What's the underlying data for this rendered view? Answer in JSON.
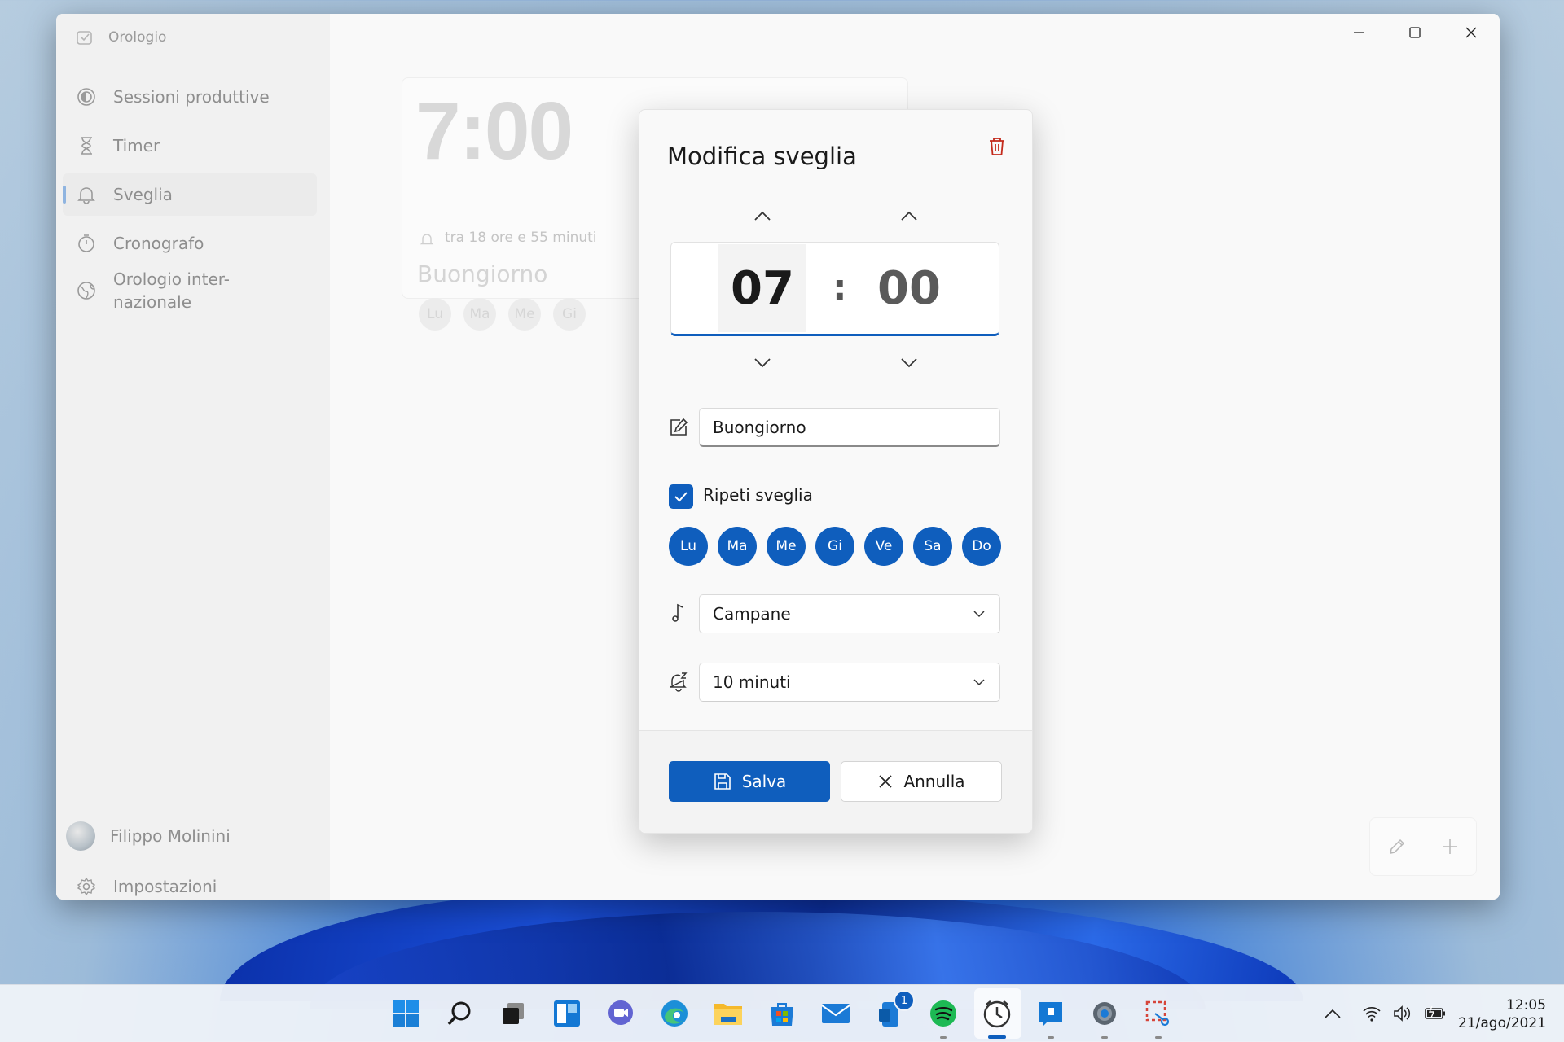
{
  "app": {
    "title": "Orologio"
  },
  "sidebar": {
    "items": [
      {
        "label": "Sessioni produttive"
      },
      {
        "label": "Timer"
      },
      {
        "label": "Sveglia"
      },
      {
        "label": "Cronografo"
      },
      {
        "label_line1": "Orologio inter-",
        "label_line2": "nazionale"
      }
    ],
    "user": {
      "name": "Filippo Molinini"
    },
    "settings_label": "Impostazioni"
  },
  "alarm_card": {
    "time": "7:00",
    "remaining": "tra 18 ore e 55 minuti",
    "name": "Buongiorno",
    "days": [
      "Lu",
      "Ma",
      "Me",
      "Gi"
    ]
  },
  "dialog": {
    "title": "Modifica sveglia",
    "hour": "07",
    "separator": ":",
    "minute": "00",
    "alarm_name": "Buongiorno",
    "repeat_label": "Ripeti sveglia",
    "repeat_checked": true,
    "days": [
      "Lu",
      "Ma",
      "Me",
      "Gi",
      "Ve",
      "Sa",
      "Do"
    ],
    "sound": "Campane",
    "snooze": "10 minuti",
    "save_label": "Salva",
    "cancel_label": "Annulla"
  },
  "taskbar": {
    "apps": [
      "start-icon",
      "search-icon",
      "task-view-icon",
      "widgets-icon",
      "teams-chat-icon",
      "edge-icon",
      "file-explorer-icon",
      "store-icon",
      "mail-icon",
      "phone-icon",
      "spotify-icon",
      "clock-app-icon",
      "feedback-icon",
      "settings-icon",
      "snipping-tool-icon"
    ],
    "phone_badge": "1",
    "time": "12:05",
    "date": "21/ago/2021"
  },
  "colors": {
    "accent": "#0f5ebd",
    "window_bg": "#f3f3f3"
  }
}
